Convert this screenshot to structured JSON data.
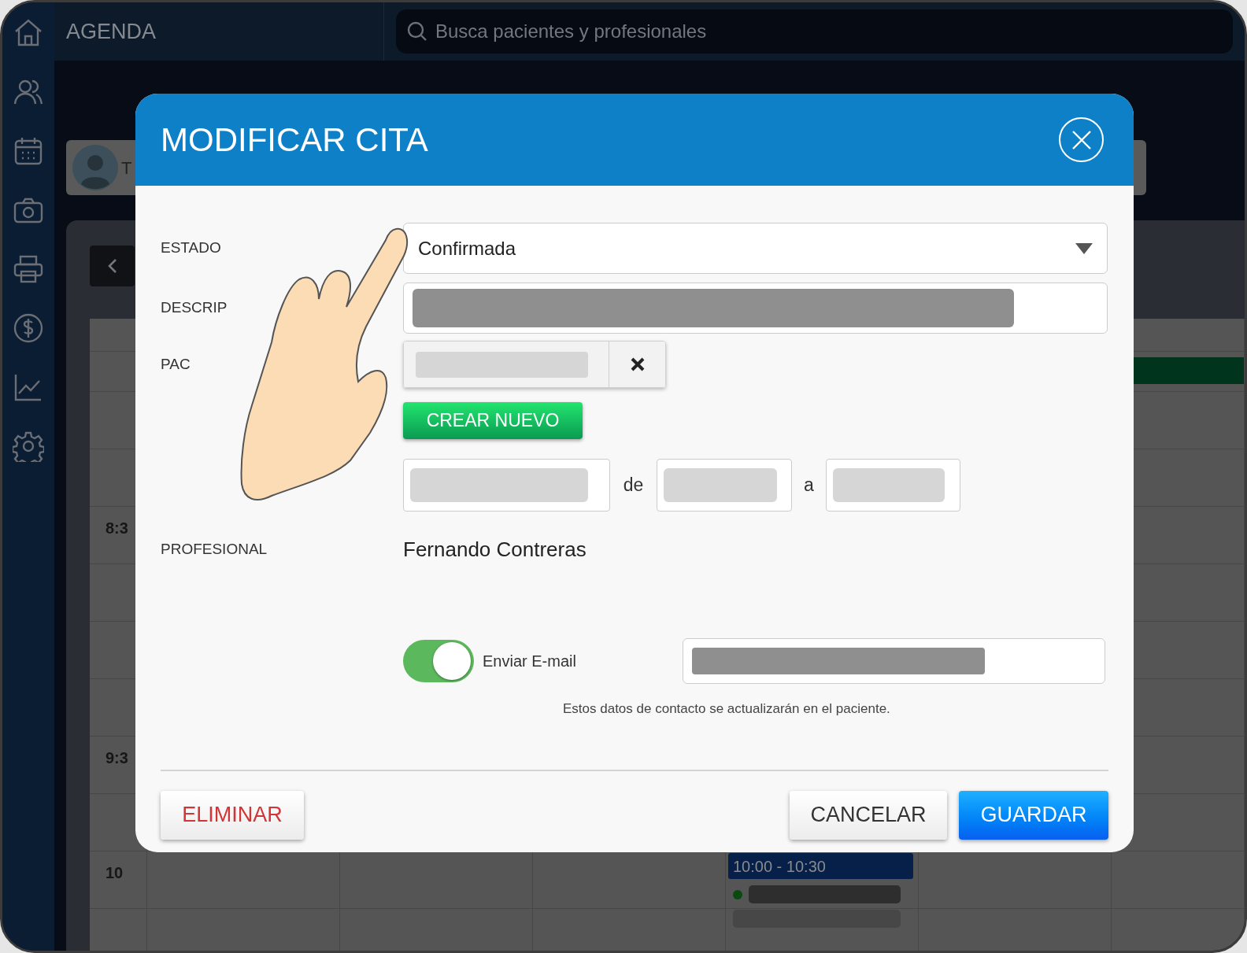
{
  "top_bar": {
    "title": "AGENDA",
    "search": {
      "placeholder": "Busca pacientes y profesionales"
    }
  },
  "profile_card": {
    "name": "T"
  },
  "calendar": {
    "time_labels": [
      "8:3",
      "9:3",
      "10"
    ],
    "event": {
      "time": "10:00 - 10:30"
    }
  },
  "modal": {
    "title": "MODIFICAR CITA",
    "fields": [
      {
        "label": "ESTADO",
        "kind": "select",
        "value": "Confirmada"
      },
      {
        "label": "DESCRIP",
        "kind": "text"
      },
      {
        "label": "PAC",
        "kind": "patient"
      }
    ],
    "create_button": "CREAR NUEVO",
    "schedule": {
      "from_word": "de",
      "to_word": "a"
    },
    "professional": {
      "label": "PROFESIONAL",
      "value": "Fernando Contreras"
    },
    "email": {
      "label": "Enviar E-mail",
      "on": true,
      "note": "Estos datos de contacto se actualizarán en el paciente."
    },
    "buttons": [
      {
        "label": "ELIMINAR",
        "kind": "danger"
      },
      {
        "label": "CANCELAR",
        "kind": "secondary"
      },
      {
        "label": "GUARDAR",
        "kind": "primary"
      }
    ]
  }
}
